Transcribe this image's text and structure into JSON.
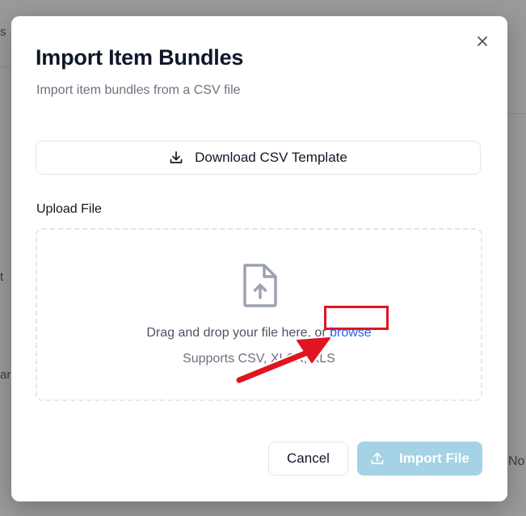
{
  "background": {
    "fragment_top": "s",
    "fragment_mid": "t",
    "fragment_low": "are",
    "fragment_bottom_right": "No"
  },
  "dialog": {
    "title": "Import Item Bundles",
    "subtitle": "Import item bundles from a CSV file",
    "close_icon": "close-icon",
    "download_button": {
      "label": "Download CSV Template",
      "icon": "download-icon"
    },
    "upload_label": "Upload File",
    "dropzone": {
      "icon": "file-upload-icon",
      "text": "Drag and drop your file here, or ",
      "browse_link": "browse",
      "supports": "Supports CSV, XLSX, XLS"
    },
    "cancel_button": "Cancel",
    "import_button": {
      "label": "Import File",
      "icon": "upload-icon",
      "disabled": true
    }
  },
  "annotation": {
    "highlight_color": "#e01521",
    "target": "browse"
  },
  "colors": {
    "link": "#2563eb",
    "import_disabled": "#a3d3e5"
  }
}
